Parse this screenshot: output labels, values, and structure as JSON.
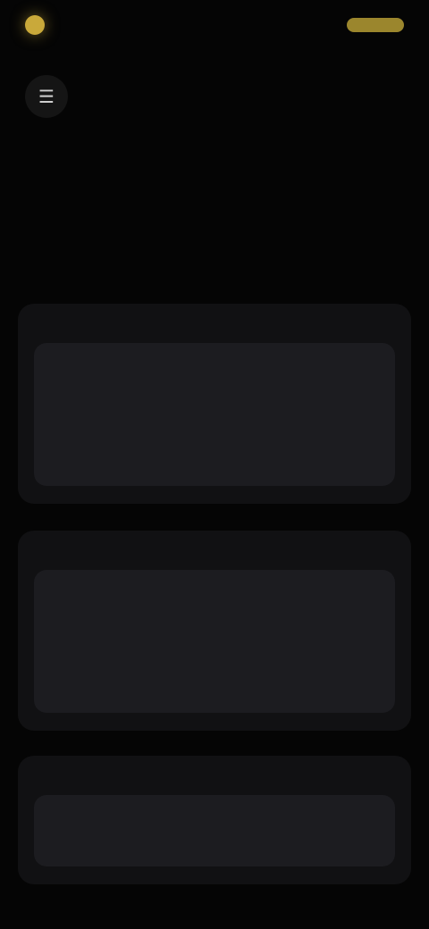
{
  "status": {
    "left_text": "",
    "right_text": ""
  },
  "header": {
    "menu_icon": "menu-icon",
    "title": ""
  },
  "hero": {
    "title": "",
    "subtitle": ""
  },
  "sections": [
    {
      "label": "",
      "card_title": "",
      "card_meta": ""
    },
    {
      "label": "",
      "card_title": "",
      "card_meta": ""
    },
    {
      "label": "",
      "card_title": "",
      "card_meta": ""
    }
  ],
  "colors": {
    "accent": "#7c73c9",
    "highlight": "#c9a93a",
    "background": "#050505",
    "card": "#1c1c20"
  }
}
